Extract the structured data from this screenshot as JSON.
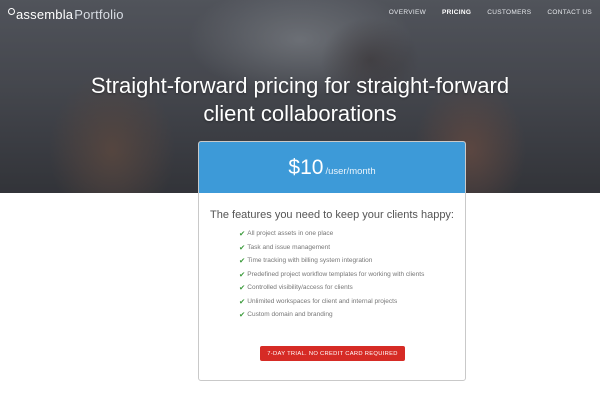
{
  "header": {
    "logo_brand": "assembla",
    "logo_product": "Portfolio",
    "nav": [
      {
        "label": "OVERVIEW",
        "active": false
      },
      {
        "label": "PRICING",
        "active": true
      },
      {
        "label": "CUSTOMERS",
        "active": false
      },
      {
        "label": "CONTACT US",
        "active": false
      }
    ]
  },
  "hero": {
    "title_line1": "Straight-forward pricing for straight-forward",
    "title_line2": "client collaborations"
  },
  "pricing": {
    "amount": "$10",
    "unit": "/user/month",
    "heading": "The features you need to keep your clients happy:",
    "check_icon": "check-icon",
    "features": [
      "All project assets in one place",
      "Task and issue management",
      "Time tracking with billing system integration",
      "Predefined project workflow templates for working with clients",
      "Controlled visibility/access for clients",
      "Unlimited workspaces for client and internal projects",
      "Custom domain and branding"
    ],
    "cta_label": "7-DAY TRIAL. NO CREDIT CARD REQUIRED"
  },
  "colors": {
    "price_band": "#3d9ad8",
    "cta": "#d62b25",
    "check": "#3a9a3a"
  }
}
